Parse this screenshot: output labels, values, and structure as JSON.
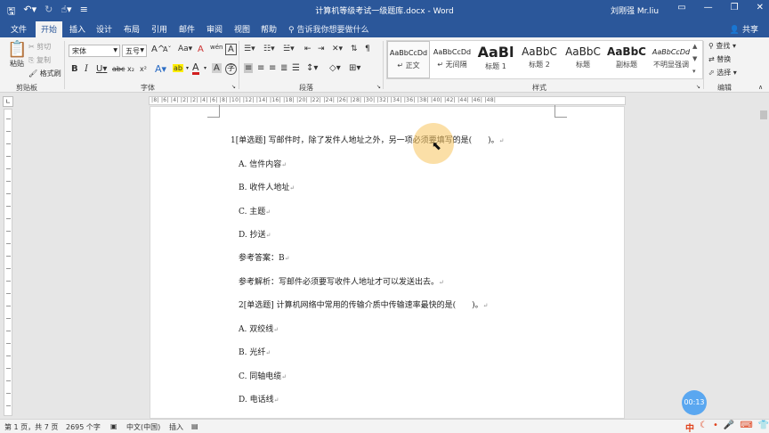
{
  "titlebar": {
    "title": "计算机等级考试一级题库.docx - Word",
    "user": "刘刚强 Mr.liu",
    "qa_icons": [
      "save-icon",
      "undo-icon",
      "redo-icon",
      "touch-mode-icon",
      "customize-icon"
    ],
    "win_minimize": "—",
    "win_restore": "❐",
    "win_close": "✕"
  },
  "tabs": [
    {
      "label": "文件"
    },
    {
      "label": "开始"
    },
    {
      "label": "插入"
    },
    {
      "label": "设计"
    },
    {
      "label": "布局"
    },
    {
      "label": "引用"
    },
    {
      "label": "邮件"
    },
    {
      "label": "审阅"
    },
    {
      "label": "视图"
    },
    {
      "label": "帮助"
    }
  ],
  "tell_me": "告诉我你想要做什么",
  "share": "共享",
  "clipboard": {
    "paste": "粘贴",
    "cut": "剪切",
    "copy": "复制",
    "format_painter": "格式刷",
    "label": "剪贴板"
  },
  "font": {
    "name": "宋体",
    "size": "五号",
    "grow": "A",
    "shrink": "A",
    "change_case": "Aa",
    "clear": "A",
    "phonetic": "wén",
    "border": "A",
    "bold": "B",
    "italic": "I",
    "underline": "U",
    "strikethrough": "abc",
    "subscript": "x₂",
    "superscript": "x²",
    "text_effects": "A",
    "highlight": "ab",
    "font_color": "A",
    "shading": "A",
    "enclose": "字",
    "label": "字体"
  },
  "paragraph": {
    "label": "段落"
  },
  "styles": {
    "label": "样式",
    "items": [
      {
        "sample": "AaBbCcDd",
        "name": "↵ 正文"
      },
      {
        "sample": "AaBbCcDd",
        "name": "↵ 无间隔"
      },
      {
        "sample": "AaBl",
        "name": "标题 1"
      },
      {
        "sample": "AaBbC",
        "name": "标题 2"
      },
      {
        "sample": "AaBbC",
        "name": "标题"
      },
      {
        "sample": "AaBbC",
        "name": "副标题"
      },
      {
        "sample": "AaBbCcDd",
        "name": "不明显强调"
      }
    ]
  },
  "editing": {
    "find": "查找",
    "replace": "替换",
    "select": "选择",
    "label": "编辑"
  },
  "ruler_text": "|8| |6| |4| |2| |2| |4| |6| |8| |10| |12| |14| |16| |18| |20| |22| |24| |26| |28| |30| |32| |34| |36| |38| |40| |42| |44| |46| |48|",
  "document": {
    "lines": [
      "1[单选题] 写邮件时，除了发件人地址之外，另一项必须要填写的是(　　)。",
      "A. 信件内容",
      "B. 收件人地址",
      "C. 主题",
      "D. 抄送",
      "参考答案：B",
      "参考解析：写邮件必须要写收件人地址才可以发送出去。",
      "2[单选题] 计算机网络中常用的传输介质中传输速率最快的是(　　)。",
      "A. 双绞线",
      "B. 光纤",
      "C. 同轴电缆",
      "D. 电话线"
    ],
    "paragraph_mark": "↵"
  },
  "timer": "00:13",
  "statusbar": {
    "page": "第 1 页，共 7 页",
    "words": "2695 个字",
    "language": "中文(中国)",
    "mode": "插入"
  },
  "ime": {
    "lang": "中",
    "icons": [
      "moon-icon",
      "dot-icon",
      "mic-icon",
      "keyboard-icon",
      "shirt-icon",
      "grid-icon"
    ]
  }
}
